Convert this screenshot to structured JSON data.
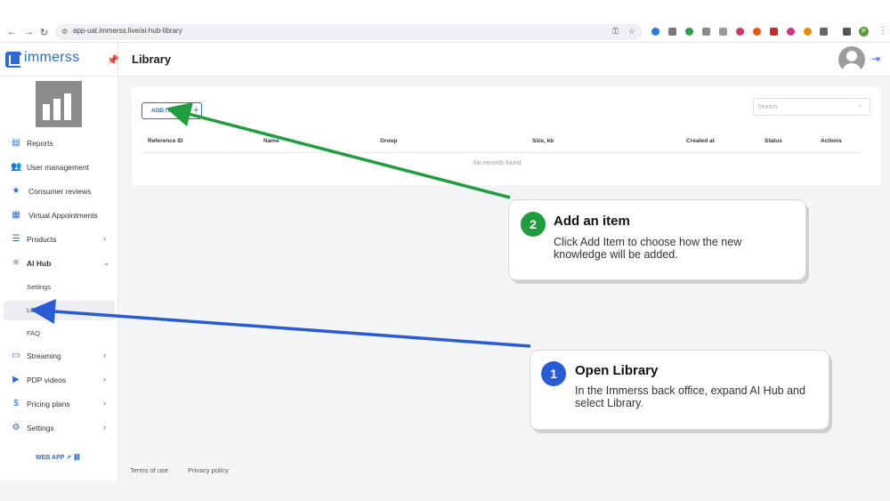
{
  "browser": {
    "url": "app-uat.immerss.live/ai-hub-library",
    "profile_initial": "P"
  },
  "sidebar": {
    "brand": "immerss",
    "items": [
      {
        "label": "Reports",
        "icon": "reports-icon"
      },
      {
        "label": "User management",
        "icon": "users-icon"
      },
      {
        "label": "Consumer reviews",
        "icon": "star-icon"
      },
      {
        "label": "Virtual Appointments",
        "icon": "calendar-icon"
      },
      {
        "label": "Products",
        "icon": "list-icon"
      },
      {
        "label": "AI Hub",
        "icon": "ai-hub-icon"
      },
      {
        "label": "Settings"
      },
      {
        "label": "Library"
      },
      {
        "label": "FAQ"
      },
      {
        "label": "Streaming",
        "icon": "monitor-icon"
      },
      {
        "label": "PDP videos",
        "icon": "video-icon"
      },
      {
        "label": "Pricing plans",
        "icon": "pricing-icon"
      },
      {
        "label": "Settings",
        "icon": "gear-icon"
      }
    ],
    "web_app": "WEB APP"
  },
  "header": {
    "title": "Library"
  },
  "library": {
    "add_item": "ADD ITEM",
    "search_placeholder": "Search",
    "columns": [
      "Reference ID",
      "Name",
      "Group",
      "Size, kb",
      "Created at",
      "Status",
      "Actions"
    ],
    "empty_text": "No records found"
  },
  "footer": {
    "terms": "Terms of use",
    "privacy": "Privacy policy"
  },
  "callouts": [
    {
      "step": "2",
      "title": "Add an item",
      "text": "Click Add Item to choose how the new knowledge will be added.",
      "color": "#1f9d3f"
    },
    {
      "step": "1",
      "title": "Open Library",
      "text": "In the Immerss back office, expand AI Hub and select Library.",
      "color": "#2a5bd7"
    }
  ],
  "colors": {
    "accent": "#2c6bd6",
    "green_arrow": "#1f9d3f",
    "blue_arrow": "#2a5bd7"
  }
}
